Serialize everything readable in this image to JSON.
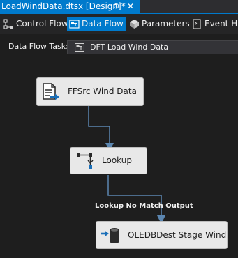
{
  "document_tab": {
    "title": "LoadWindData.dtsx [Design]*",
    "pin_glyph": "⊕",
    "close_glyph": "✕"
  },
  "view_tabs": [
    {
      "label": "Control Flow",
      "icon": "control-flow-icon",
      "active": false
    },
    {
      "label": "Data Flow",
      "icon": "data-flow-icon",
      "active": true
    },
    {
      "label": "Parameters",
      "icon": "parameters-icon",
      "active": false
    },
    {
      "label": "Event Han",
      "icon": "event-handlers-icon",
      "active": false
    }
  ],
  "task_row": {
    "label": "Data Flow Task:",
    "selected_value": "DFT Load Wind Data",
    "icon": "data-flow-task-icon"
  },
  "components": [
    {
      "label": "FFSrc Wind Data",
      "icon": "flat-file-source-icon"
    },
    {
      "label": "Lookup",
      "icon": "lookup-icon"
    },
    {
      "label": "OLEDBDest Stage Wind",
      "icon": "oledb-destination-icon"
    }
  ],
  "paths": [
    {
      "from": "FFSrc Wind Data",
      "to": "Lookup",
      "label": ""
    },
    {
      "from": "Lookup",
      "to": "OLEDBDest Stage Wind",
      "label": "Lookup No Match Output"
    }
  ],
  "colors": {
    "accent": "#007acc",
    "background": "#1e1e1e",
    "component_fill": "#e8e8e8",
    "path_line": "#5b86b0"
  }
}
